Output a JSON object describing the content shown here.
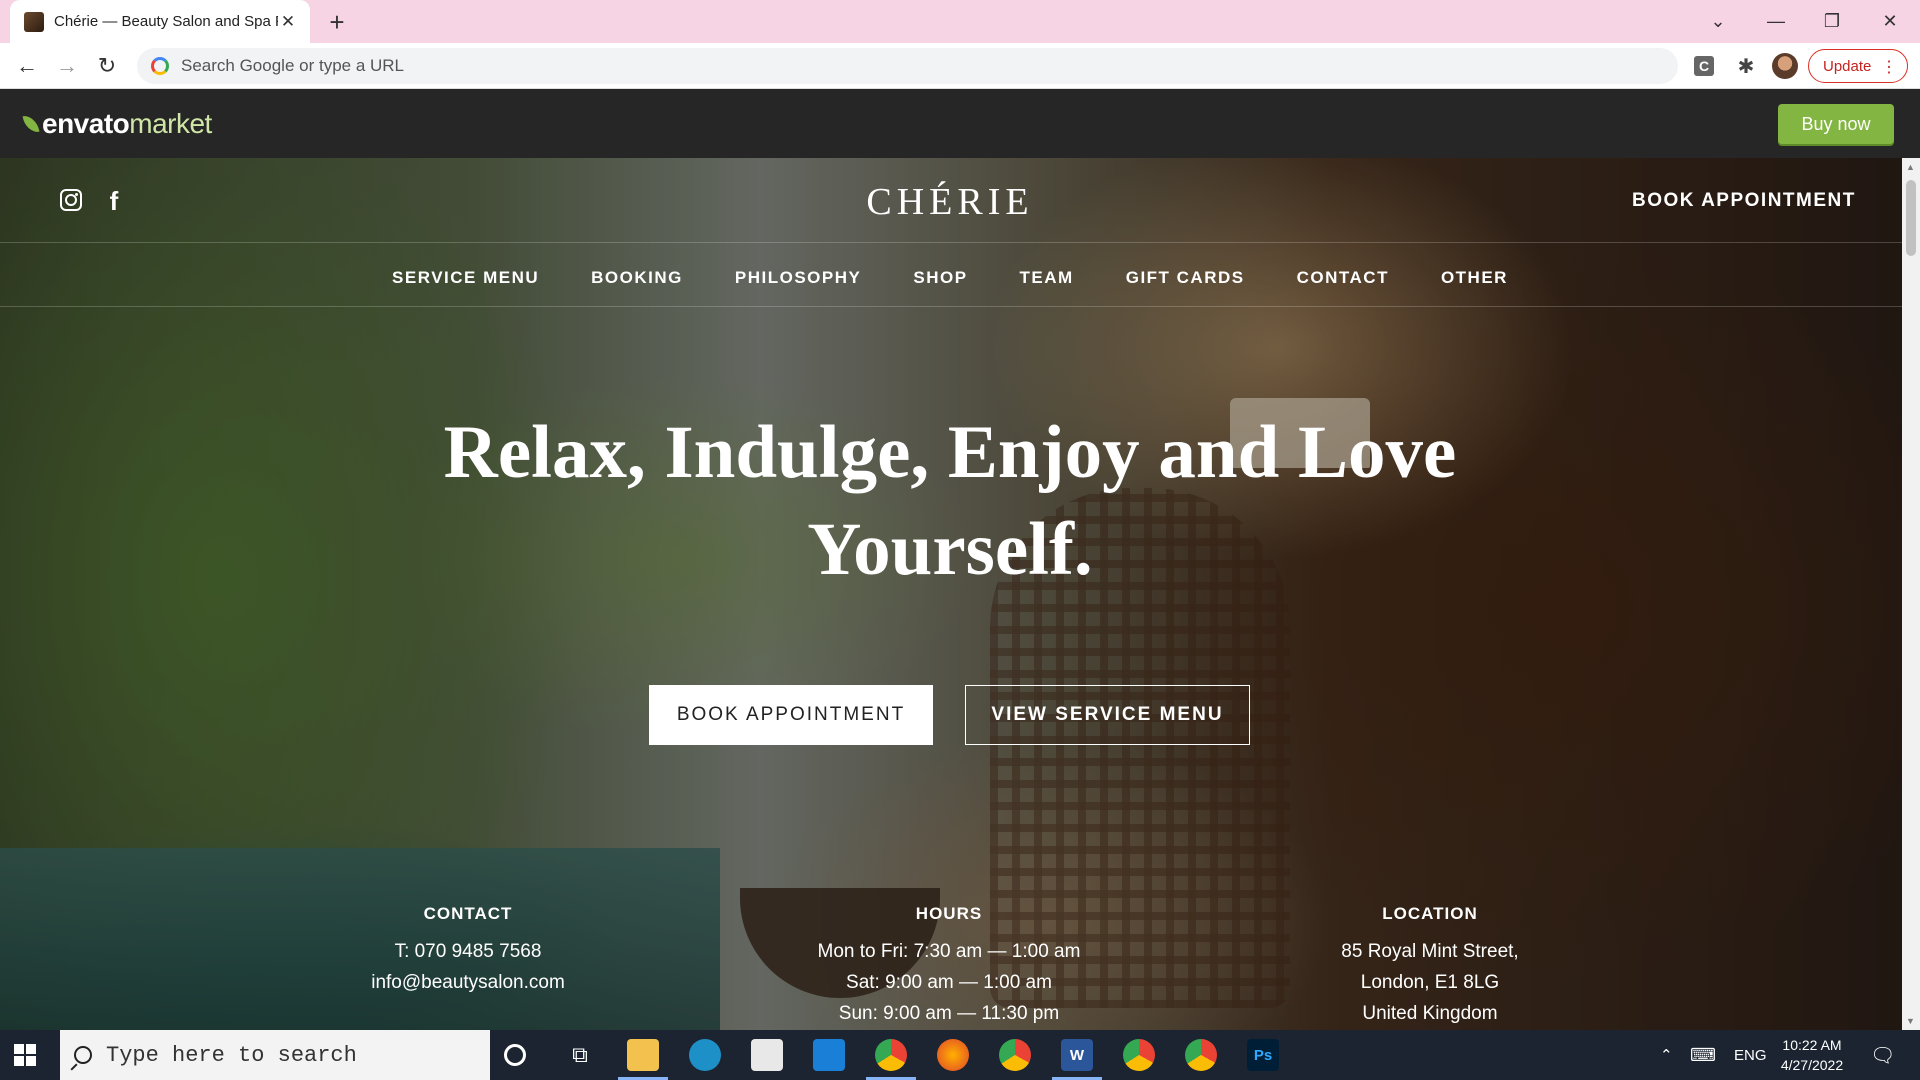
{
  "browser": {
    "tab_title": "Chérie — Beauty Salon and Spa Pre",
    "omnibox_placeholder": "Search Google or type a URL",
    "update_label": "Update",
    "ext_c_label": "C"
  },
  "envato": {
    "logo_part1": "envato",
    "logo_part2": "market",
    "buy_now": "Buy now",
    "brand_color": "#82b541"
  },
  "site": {
    "brand": "CHÉRIE",
    "header_book": "BOOK APPOINTMENT",
    "nav": [
      "SERVICE MENU",
      "BOOKING",
      "PHILOSOPHY",
      "SHOP",
      "TEAM",
      "GIFT CARDS",
      "CONTACT",
      "OTHER"
    ],
    "headline_line1": "Relax, Indulge, Enjoy and Love",
    "headline_line2": "Yourself.",
    "cta_book": "BOOK APPOINTMENT",
    "cta_view": "VIEW SERVICE MENU",
    "contact": {
      "heading": "CONTACT",
      "phone": "T: 070 9485 7568",
      "email": "info@beautysalon.com"
    },
    "hours": {
      "heading": "HOURS",
      "weekdays": "Mon to Fri: 7:30 am — 1:00 am",
      "saturday": "Sat: 9:00 am — 1:00 am",
      "sunday": "Sun: 9:00 am — 11:30 pm"
    },
    "location": {
      "heading": "LOCATION",
      "street": "85 Royal Mint Street,",
      "city": "London, E1 8LG",
      "country": "United Kingdom"
    }
  },
  "taskbar": {
    "search_placeholder": "Type here to search",
    "apps": [
      "cortana-icon",
      "task-view-icon",
      "file-explorer-icon",
      "edge-icon",
      "store-icon",
      "mail-icon",
      "chrome-icon",
      "firefox-icon",
      "chrome-profile-icon",
      "word-icon",
      "chrome-profile-2-icon",
      "chrome-profile-3-icon",
      "photoshop-icon"
    ],
    "word_label": "W",
    "ps_label": "Ps",
    "language": "ENG",
    "time": "10:22 AM",
    "date": "4/27/2022"
  }
}
